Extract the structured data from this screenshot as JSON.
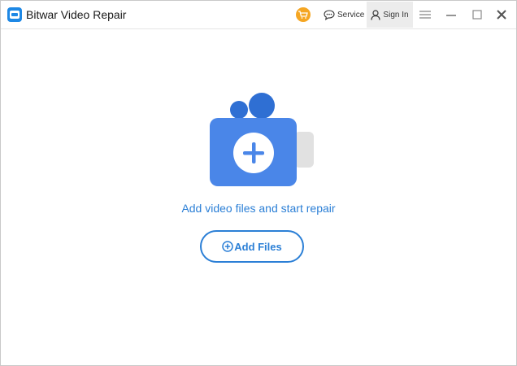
{
  "app": {
    "title": "Bitwar Video Repair",
    "logo_icon": "bitwar-logo-icon"
  },
  "titlebar": {
    "service_label": "Service",
    "signin_label": "Sign In",
    "icons": [
      "cart-icon",
      "chat-icon",
      "user-icon",
      "menu-icon",
      "minimize-icon",
      "maximize-icon",
      "close-icon"
    ]
  },
  "main": {
    "prompt": "Add video files and start repair",
    "add_files_label": "Add Files",
    "illustration_icon": "video-camera-add-icon"
  },
  "colors": {
    "accent": "#2b7fd6",
    "camera_blue": "#4a86e8",
    "cart_orange": "#f5a623"
  }
}
